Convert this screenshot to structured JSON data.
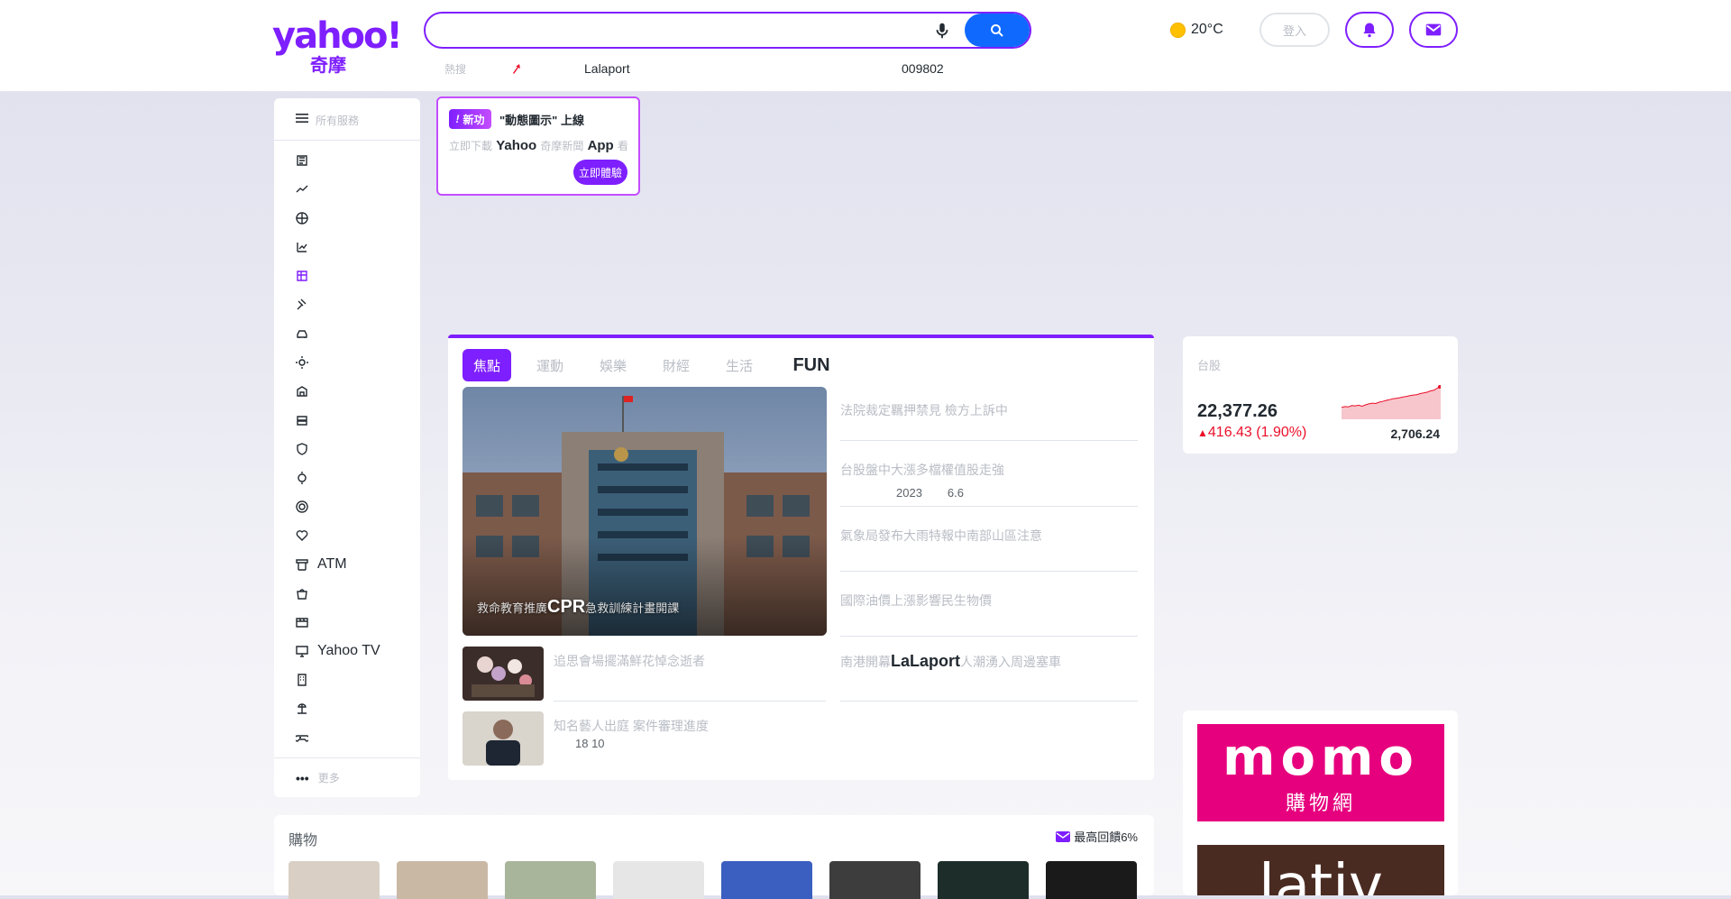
{
  "header": {
    "logo_word": "yahoo!",
    "logo_sub": "奇摩",
    "search_value": "",
    "weather_temp": "20°C",
    "signin_label": "登入",
    "trending": [
      "熱搜",
      "Lalaport",
      "009802"
    ]
  },
  "sidebar": {
    "title": "所有服務",
    "items": [
      {
        "label": "",
        "icon": "news-icon"
      },
      {
        "label": "",
        "icon": "finance-icon"
      },
      {
        "label": "",
        "icon": "sports-icon"
      },
      {
        "label": "",
        "icon": "stock-icon"
      },
      {
        "label": "",
        "icon": "shopping-icon"
      },
      {
        "label": "",
        "icon": "auction-icon"
      },
      {
        "label": "",
        "icon": "car-icon"
      },
      {
        "label": "",
        "icon": "weather-icon"
      },
      {
        "label": "",
        "icon": "house-icon"
      },
      {
        "label": "",
        "icon": "money-icon"
      },
      {
        "label": "",
        "icon": "security-icon"
      },
      {
        "label": "",
        "icon": "horoscope-icon"
      },
      {
        "label": "",
        "icon": "lottery-icon"
      },
      {
        "label": "",
        "icon": "health-icon"
      },
      {
        "label": "ATM",
        "icon": "atm-icon"
      },
      {
        "label": "",
        "icon": "bag-icon"
      },
      {
        "label": "",
        "icon": "movie-icon"
      },
      {
        "label": "Yahoo TV",
        "icon": "tv-icon"
      },
      {
        "label": "",
        "icon": "building-icon"
      },
      {
        "label": "",
        "icon": "travel-icon"
      },
      {
        "label": "",
        "icon": "game-icon"
      }
    ],
    "more_label": "更多"
  },
  "promo": {
    "badge": "新功",
    "line1": "\"動態圖示\" 上線",
    "line2_a": "立即下載",
    "line2_b": "Yahoo",
    "line2_c": "奇摩新聞",
    "line2_d": "App",
    "line2_e": "看",
    "button": "立即體驗"
  },
  "news": {
    "tabs": [
      "焦點",
      "運動",
      "娛樂",
      "財經",
      "生活",
      "FUN"
    ],
    "hero_caption_a": "救命教育推廣",
    "hero_caption_b": "CPR",
    "hero_caption_c": "急救訓練計畫開課",
    "headlines": [
      {
        "title": "法院裁定羈押禁見 檢方上訴中",
        "sub": ""
      },
      {
        "title": "台股盤中大漲多檔權值股走強",
        "sub_a": "2023",
        "sub_b": "6.6"
      },
      {
        "title": "氣象局發布大雨特報中南部山區注意",
        "sub": ""
      },
      {
        "title": "國際油價上漲影響民生物價",
        "sub": ""
      }
    ],
    "lala_a": "南港開幕",
    "lala_b": "LaLaport",
    "lala_c": "人潮湧入周邊塞車",
    "small": [
      {
        "title": "追思會場擺滿鮮花悼念逝者",
        "meta": ""
      },
      {
        "title": "知名藝人出庭 案件審理進度",
        "meta": "18 10"
      }
    ]
  },
  "market": {
    "title": "台股",
    "price": "22,377.26",
    "change": "416.43 (1.90%)",
    "volume": "2,706.24",
    "spark": [
      0.3,
      0.32,
      0.31,
      0.35,
      0.34,
      0.36,
      0.33,
      0.37,
      0.4,
      0.42,
      0.41,
      0.45,
      0.47,
      0.5,
      0.52,
      0.55,
      0.56,
      0.58,
      0.6,
      0.62,
      0.64,
      0.66,
      0.67,
      0.7,
      0.72,
      0.74,
      0.78,
      0.8,
      0.86,
      0.9
    ]
  },
  "shop": {
    "title": "購物",
    "promo": "最高回饋6%"
  },
  "ads": {
    "momo_main": "momo",
    "momo_sub": "購物網",
    "lativ": "lativ"
  }
}
